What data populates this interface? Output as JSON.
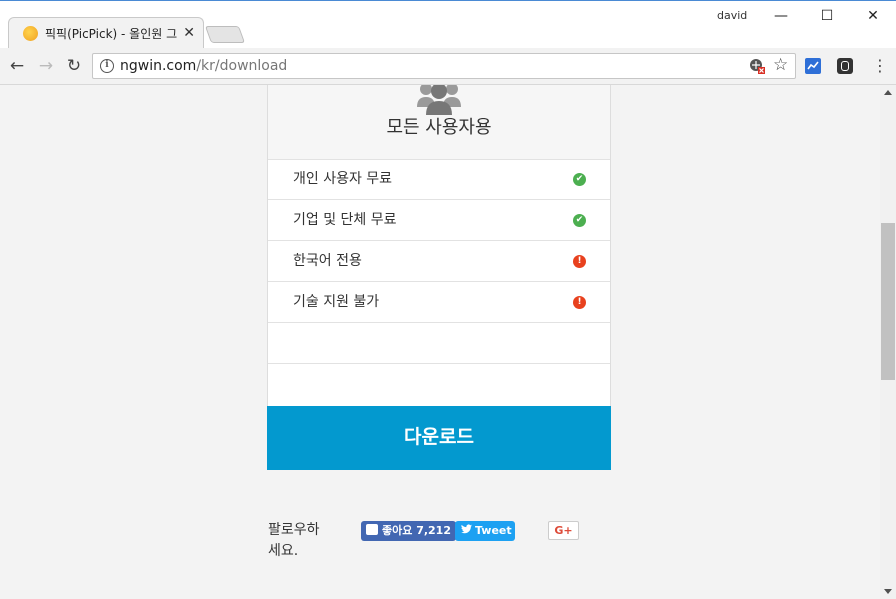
{
  "browser": {
    "tab_title": "픽픽(PicPick) - 올인원 그",
    "tab_close": "✕",
    "user": "david",
    "window": {
      "minimize": "—",
      "maximize": "☐",
      "close": "✕"
    },
    "nav": {
      "back": "←",
      "forward": "→",
      "reload": "↻"
    },
    "url_host": "ngwin.com",
    "url_path": "/kr/download",
    "info_glyph": "i",
    "star_glyph": "☆",
    "menu_glyph": "⋮",
    "icons": [
      "page-info-icon",
      "blocked-content-icon",
      "bookmark-star-icon",
      "chart-extension-icon",
      "lightbulb-extension-icon",
      "menu-dots-icon"
    ]
  },
  "page": {
    "plan_title": "모든 사용자용",
    "features": [
      {
        "label": "개인 사용자 무료",
        "status": "ok",
        "icon": "check-circle-icon",
        "glyph": "✔"
      },
      {
        "label": "기업 및 단체 무료",
        "status": "ok",
        "icon": "check-circle-icon",
        "glyph": "✔"
      },
      {
        "label": "한국어 전용",
        "status": "warn",
        "icon": "exclamation-circle-icon",
        "glyph": "!"
      },
      {
        "label": "기술 지원 불가",
        "status": "warn",
        "icon": "exclamation-circle-icon",
        "glyph": "!"
      }
    ],
    "download_label": "다운로드",
    "follow_label": "팔로우하세요.",
    "facebook_like": "좋아요 7,212",
    "tweet_label": "Tweet",
    "tweet_glyph": "🐦",
    "gplus_label": "G+",
    "colors": {
      "download_bg": "#0399cf",
      "ok": "#4caf50",
      "warn": "#e8411e",
      "facebook": "#4267b2",
      "twitter": "#1da1f2"
    }
  }
}
